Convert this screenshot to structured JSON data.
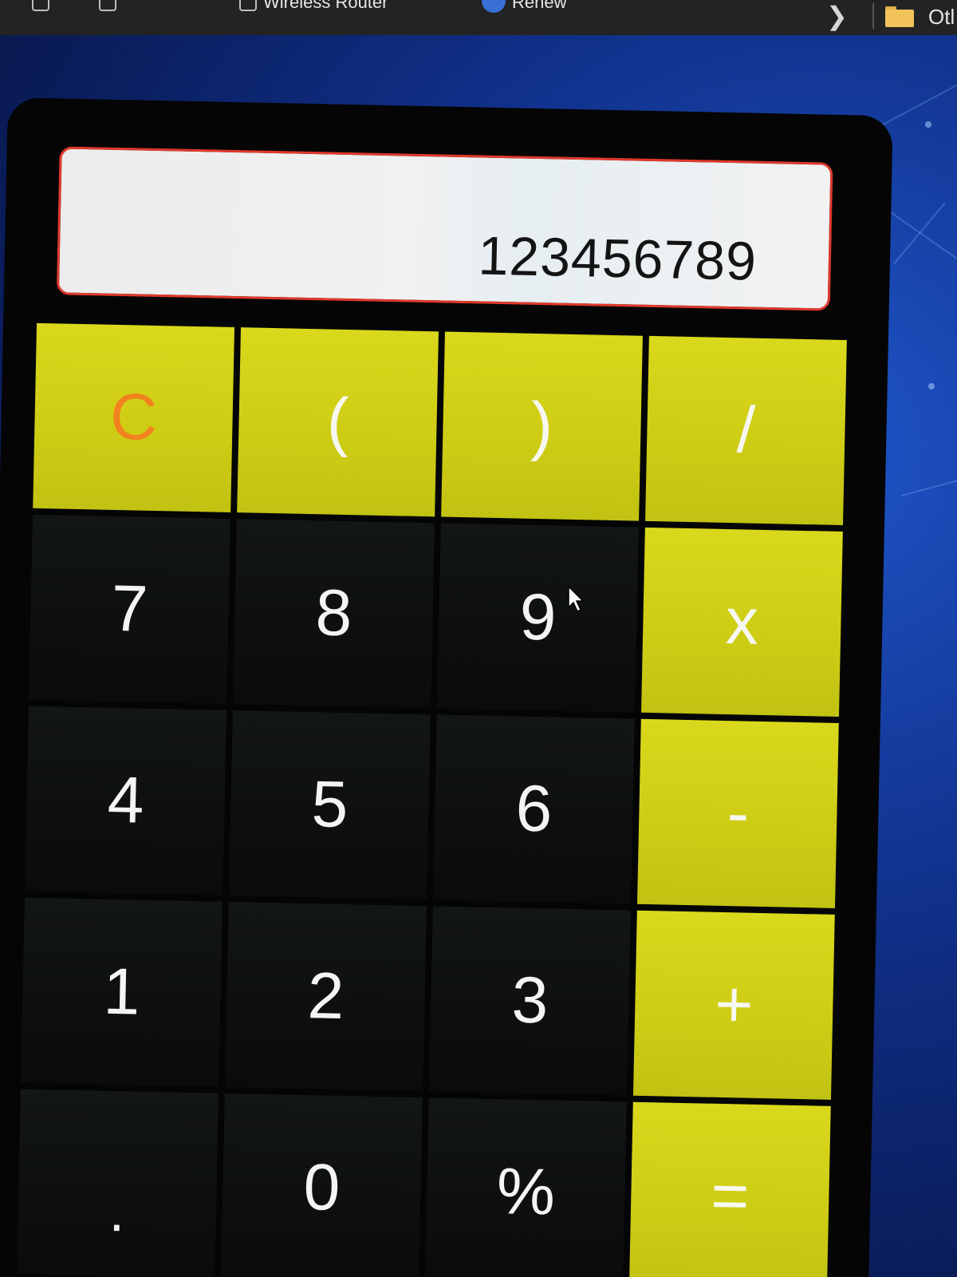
{
  "bookmarks": {
    "items": [
      {
        "label": "Wireless Router"
      },
      {
        "label": "Renew"
      }
    ],
    "overflow_label": "Otl"
  },
  "calculator": {
    "display_value": "123456789",
    "colors": {
      "accent": "#d3d31a",
      "clear_text": "#f2821f",
      "display_border": "#e0392b"
    },
    "keys": [
      {
        "label": "C",
        "type": "clear"
      },
      {
        "label": "(",
        "type": "operator"
      },
      {
        "label": ")",
        "type": "operator"
      },
      {
        "label": "/",
        "type": "operator"
      },
      {
        "label": "7",
        "type": "digit"
      },
      {
        "label": "8",
        "type": "digit"
      },
      {
        "label": "9",
        "type": "digit"
      },
      {
        "label": "x",
        "type": "operator"
      },
      {
        "label": "4",
        "type": "digit"
      },
      {
        "label": "5",
        "type": "digit"
      },
      {
        "label": "6",
        "type": "digit"
      },
      {
        "label": "-",
        "type": "operator"
      },
      {
        "label": "1",
        "type": "digit"
      },
      {
        "label": "2",
        "type": "digit"
      },
      {
        "label": "3",
        "type": "digit"
      },
      {
        "label": "+",
        "type": "operator"
      },
      {
        "label": ".",
        "type": "digit"
      },
      {
        "label": "0",
        "type": "digit"
      },
      {
        "label": "%",
        "type": "digit"
      },
      {
        "label": "=",
        "type": "equals"
      }
    ]
  },
  "icons": {
    "bookmark": "bookmark-page-icon",
    "globe": "globe-icon",
    "chevron": "chevron-right-icon",
    "folder": "folder-icon",
    "cursor": "mouse-pointer-icon"
  }
}
